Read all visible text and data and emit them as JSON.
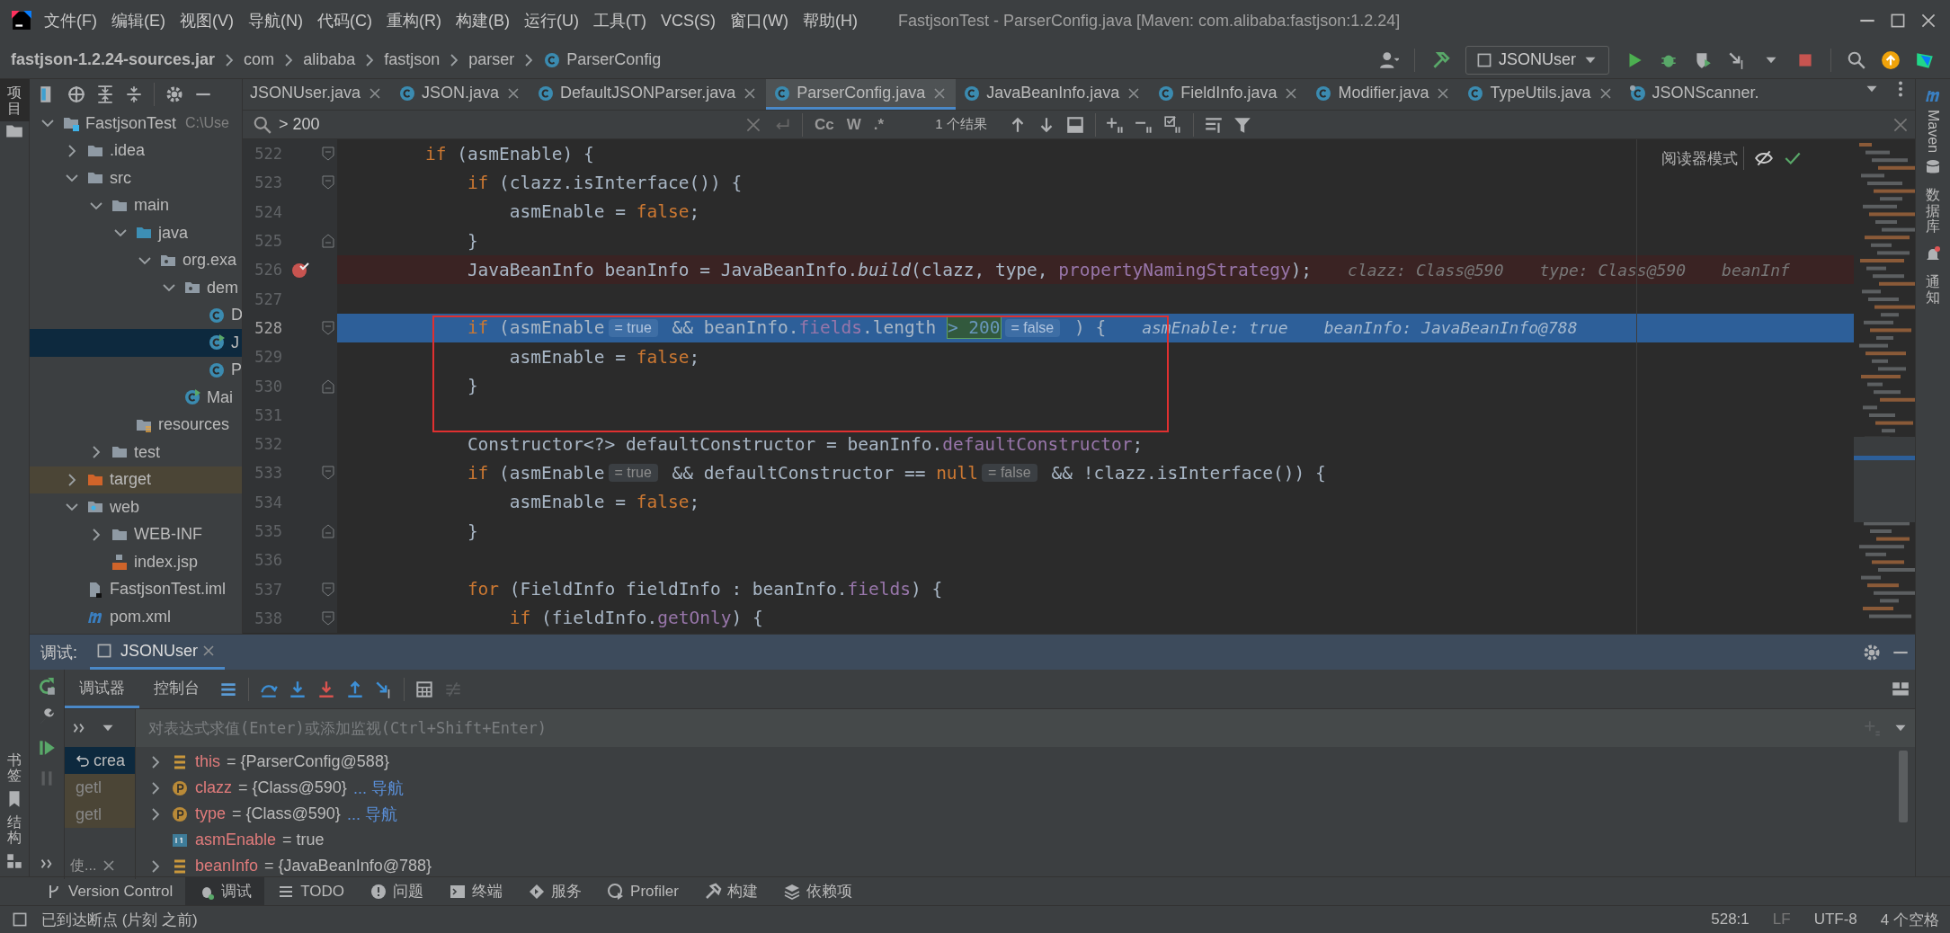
{
  "window": {
    "title": "FastjsonTest - ParserConfig.java [Maven: com.alibaba:fastjson:1.2.24]"
  },
  "menu": [
    "文件(F)",
    "编辑(E)",
    "视图(V)",
    "导航(N)",
    "代码(C)",
    "重构(R)",
    "构建(B)",
    "运行(U)",
    "工具(T)",
    "VCS(S)",
    "窗口(W)",
    "帮助(H)"
  ],
  "breadcrumb": [
    {
      "label": "fastjson-1.2.24-sources.jar",
      "kind": "jar"
    },
    {
      "label": "com",
      "kind": "package"
    },
    {
      "label": "alibaba",
      "kind": "package"
    },
    {
      "label": "fastjson",
      "kind": "package"
    },
    {
      "label": "parser",
      "kind": "package"
    },
    {
      "label": "ParserConfig",
      "kind": "class"
    }
  ],
  "run_config": "JSONUser",
  "side_tabs_left": [
    {
      "label": "项目",
      "selected": true
    },
    {
      "label": "书签",
      "selected": false
    },
    {
      "label": "结构",
      "selected": false
    }
  ],
  "side_tabs_right": [
    {
      "label": "Maven",
      "kind": "maven"
    },
    {
      "label": "数据库",
      "kind": "database"
    },
    {
      "label": "通知",
      "kind": "notifications"
    }
  ],
  "project_tree": [
    {
      "label": "FastjsonTest",
      "path": "C:\\Use",
      "kind": "module",
      "expanded": true,
      "selected": false,
      "children": [
        {
          "label": ".idea",
          "kind": "folder",
          "expanded": false,
          "selected": false
        },
        {
          "label": "src",
          "kind": "folder",
          "expanded": true,
          "selected": false,
          "children": [
            {
              "label": "main",
              "kind": "folder",
              "expanded": true,
              "selected": false,
              "children": [
                {
                  "label": "java",
                  "kind": "source-folder",
                  "expanded": true,
                  "selected": false,
                  "children": [
                    {
                      "label": "org.exa",
                      "kind": "package",
                      "expanded": true,
                      "selected": false,
                      "children": [
                        {
                          "label": "dem",
                          "kind": "package",
                          "expanded": true,
                          "selected": false,
                          "children": [
                            {
                              "label": "D",
                              "kind": "class",
                              "selected": false
                            },
                            {
                              "label": "J",
                              "kind": "runnable-class",
                              "selected": true
                            },
                            {
                              "label": "P",
                              "kind": "class",
                              "selected": false
                            }
                          ]
                        },
                        {
                          "label": "Mai",
                          "kind": "runnable-class",
                          "selected": false
                        }
                      ]
                    }
                  ]
                },
                {
                  "label": "resources",
                  "kind": "resource-folder",
                  "selected": false
                }
              ]
            },
            {
              "label": "test",
              "kind": "folder",
              "expanded": false,
              "selected": false
            }
          ]
        },
        {
          "label": "target",
          "kind": "excluded-folder",
          "expanded": false,
          "selected": false
        },
        {
          "label": "web",
          "kind": "web-folder",
          "expanded": true,
          "selected": false,
          "children": [
            {
              "label": "WEB-INF",
              "kind": "folder",
              "expanded": false,
              "selected": false
            },
            {
              "label": "index.jsp",
              "kind": "jsp",
              "selected": false
            }
          ]
        },
        {
          "label": "FastjsonTest.iml",
          "kind": "iml",
          "selected": false
        },
        {
          "label": "pom.xml",
          "kind": "maven",
          "selected": false
        }
      ]
    }
  ],
  "editor_tabs": [
    {
      "label": "JSONUser.java",
      "kind": "plain",
      "selected": false
    },
    {
      "label": "JSON.java",
      "kind": "class",
      "selected": false
    },
    {
      "label": "DefaultJSONParser.java",
      "kind": "class",
      "selected": false
    },
    {
      "label": "ParserConfig.java",
      "kind": "class",
      "selected": true
    },
    {
      "label": "JavaBeanInfo.java",
      "kind": "class",
      "selected": false
    },
    {
      "label": "FieldInfo.java",
      "kind": "class",
      "selected": false
    },
    {
      "label": "Modifier.java",
      "kind": "class",
      "selected": false
    },
    {
      "label": "TypeUtils.java",
      "kind": "class",
      "selected": false
    },
    {
      "label": "JSONScanner.",
      "kind": "class-gear",
      "selected": false
    }
  ],
  "search": {
    "value": "> 200",
    "options": [
      "Cc",
      "W",
      ".*"
    ],
    "result": "1 个结果"
  },
  "reader_mode": "阅读器模式",
  "code": [
    {
      "n": "522",
      "kind": "plain",
      "fold_start": true,
      "fold_end": false,
      "segs": [
        {
          "kind": "keyword",
          "text": "        if"
        },
        {
          "kind": "text",
          "text": " (asmEnable) {"
        }
      ]
    },
    {
      "n": "523",
      "kind": "plain",
      "fold_start": true,
      "fold_end": false,
      "segs": [
        {
          "kind": "keyword",
          "text": "            if"
        },
        {
          "kind": "text",
          "text": " (clazz.isInterface()) {"
        }
      ]
    },
    {
      "n": "524",
      "kind": "plain",
      "fold_start": false,
      "fold_end": false,
      "segs": [
        {
          "kind": "text",
          "text": "                asmEnable = "
        },
        {
          "kind": "keyword",
          "text": "false"
        },
        {
          "kind": "text",
          "text": ";"
        }
      ]
    },
    {
      "n": "525",
      "kind": "plain",
      "fold_start": false,
      "fold_end": true,
      "segs": [
        {
          "kind": "text",
          "text": "            }"
        }
      ]
    },
    {
      "n": "526",
      "kind": "breakpoint",
      "fold_start": false,
      "fold_end": false,
      "segs": [
        {
          "kind": "text",
          "text": "            JavaBeanInfo beanInfo = JavaBeanInfo."
        },
        {
          "kind": "static",
          "text": "build"
        },
        {
          "kind": "text",
          "text": "(clazz, type, "
        },
        {
          "kind": "field",
          "text": "propertyNamingStrategy"
        },
        {
          "kind": "text",
          "text": ");"
        },
        {
          "kind": "debug",
          "text": "clazz: Class@590"
        },
        {
          "kind": "debug",
          "text": "type: Class@590"
        },
        {
          "kind": "debug",
          "text": "beanInf"
        }
      ]
    },
    {
      "n": "527",
      "kind": "plain",
      "fold_start": false,
      "fold_end": false
    },
    {
      "n": "528",
      "kind": "current",
      "fold_start": true,
      "fold_end": false,
      "segs": [
        {
          "kind": "keyword",
          "text": "            if"
        },
        {
          "kind": "text",
          "text": " (asmEnable"
        },
        {
          "kind": "hint",
          "text": "= true"
        },
        {
          "kind": "text",
          "text": " && beanInfo."
        },
        {
          "kind": "field",
          "text": "fields"
        },
        {
          "kind": "text",
          "text": ".length "
        },
        {
          "kind": "match",
          "text": "> 200"
        },
        {
          "kind": "hint",
          "text": "= false"
        },
        {
          "kind": "text",
          "text": " ) {"
        },
        {
          "kind": "debug",
          "text": "asmEnable: true"
        },
        {
          "kind": "debug",
          "text": "beanInfo: JavaBeanInfo@788"
        }
      ]
    },
    {
      "n": "529",
      "kind": "plain",
      "fold_start": false,
      "fold_end": false,
      "segs": [
        {
          "kind": "text",
          "text": "                asmEnable = "
        },
        {
          "kind": "keyword",
          "text": "false"
        },
        {
          "kind": "text",
          "text": ";"
        }
      ]
    },
    {
      "n": "530",
      "kind": "plain",
      "fold_start": false,
      "fold_end": true,
      "segs": [
        {
          "kind": "text",
          "text": "            }"
        }
      ]
    },
    {
      "n": "531",
      "kind": "plain",
      "fold_start": false,
      "fold_end": false
    },
    {
      "n": "532",
      "kind": "plain",
      "fold_start": false,
      "fold_end": false,
      "segs": [
        {
          "kind": "text",
          "text": "            Constructor<?> defaultConstructor = beanInfo."
        },
        {
          "kind": "field",
          "text": "defaultConstructor"
        },
        {
          "kind": "text",
          "text": ";"
        }
      ]
    },
    {
      "n": "533",
      "kind": "plain",
      "fold_start": true,
      "fold_end": false,
      "segs": [
        {
          "kind": "keyword",
          "text": "            if"
        },
        {
          "kind": "text",
          "text": " (asmEnable"
        },
        {
          "kind": "hint",
          "text": "= true"
        },
        {
          "kind": "text",
          "text": " && defaultConstructor == "
        },
        {
          "kind": "keyword",
          "text": "null"
        },
        {
          "kind": "hint",
          "text": "= false"
        },
        {
          "kind": "text",
          "text": " && !clazz.isInterface()) {"
        }
      ]
    },
    {
      "n": "534",
      "kind": "plain",
      "fold_start": false,
      "fold_end": false,
      "segs": [
        {
          "kind": "text",
          "text": "                asmEnable = "
        },
        {
          "kind": "keyword",
          "text": "false"
        },
        {
          "kind": "text",
          "text": ";"
        }
      ]
    },
    {
      "n": "535",
      "kind": "plain",
      "fold_start": false,
      "fold_end": true,
      "segs": [
        {
          "kind": "text",
          "text": "            }"
        }
      ]
    },
    {
      "n": "536",
      "kind": "plain",
      "fold_start": false,
      "fold_end": false
    },
    {
      "n": "537",
      "kind": "plain",
      "fold_start": true,
      "fold_end": false,
      "segs": [
        {
          "kind": "keyword",
          "text": "            for"
        },
        {
          "kind": "text",
          "text": " (FieldInfo fieldInfo : beanInfo."
        },
        {
          "kind": "field",
          "text": "fields"
        },
        {
          "kind": "text",
          "text": ") {"
        }
      ]
    },
    {
      "n": "538",
      "kind": "plain",
      "fold_start": true,
      "fold_end": false,
      "segs": [
        {
          "kind": "keyword",
          "text": "                if"
        },
        {
          "kind": "text",
          "text": " (fieldInfo."
        },
        {
          "kind": "field",
          "text": "getOnly"
        },
        {
          "kind": "text",
          "text": ") {"
        }
      ]
    }
  ],
  "debug": {
    "label": "调试:",
    "session": "JSONUser",
    "tabs": [
      {
        "label": "调试器",
        "selected": true
      },
      {
        "label": "控制台",
        "selected": false
      }
    ],
    "watch_placeholder": "对表达式求值(Enter)或添加监视(Ctrl+Shift+Enter)",
    "frames": [
      {
        "label": "crea",
        "selected": true
      },
      {
        "label": "getl",
        "selected": false
      },
      {
        "label": "getl",
        "selected": false
      }
    ],
    "frames_tab": "使...",
    "variables": [
      {
        "name": "this",
        "value": "= {ParserConfig@588}",
        "kind": "object",
        "expandable": true
      },
      {
        "name": "clazz",
        "value": "= {Class@590}",
        "link": "... 导航",
        "kind": "param",
        "expandable": true
      },
      {
        "name": "type",
        "value": "= {Class@590}",
        "link": "... 导航",
        "kind": "param",
        "expandable": true
      },
      {
        "name": "asmEnable",
        "value": "= true",
        "kind": "primitive",
        "expandable": false
      },
      {
        "name": "beanInfo",
        "value": "= {JavaBeanInfo@788}",
        "kind": "object",
        "expandable": true
      }
    ]
  },
  "tool_tabs": [
    {
      "label": "Version Control",
      "kind": "vcs",
      "selected": false
    },
    {
      "label": "调试",
      "kind": "debug",
      "selected": true
    },
    {
      "label": "TODO",
      "kind": "todo",
      "selected": false
    },
    {
      "label": "问题",
      "kind": "problems",
      "selected": false
    },
    {
      "label": "终端",
      "kind": "terminal",
      "selected": false
    },
    {
      "label": "服务",
      "kind": "services",
      "selected": false
    },
    {
      "label": "Profiler",
      "kind": "profiler",
      "selected": false
    },
    {
      "label": "构建",
      "kind": "build",
      "selected": false
    },
    {
      "label": "依赖项",
      "kind": "dependencies",
      "selected": false
    }
  ],
  "status_bar": {
    "message": "已到达断点 (片刻 之前)",
    "position": "528:1",
    "line_ending": "LF",
    "encoding": "UTF-8",
    "indent": "4 个空格"
  }
}
